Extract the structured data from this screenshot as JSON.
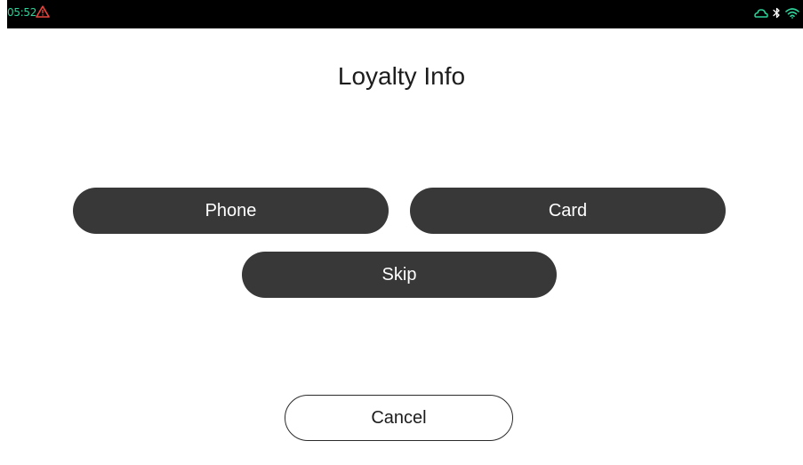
{
  "status_bar": {
    "time": "05:52",
    "warning_color": "#e8453c",
    "time_color": "#2fd39a",
    "icons": [
      "warning-icon",
      "cloud-icon",
      "bluetooth-icon",
      "wifi-icon"
    ]
  },
  "screen": {
    "title": "Loyalty Info"
  },
  "buttons": {
    "phone_label": "Phone",
    "card_label": "Card",
    "skip_label": "Skip",
    "cancel_label": "Cancel"
  },
  "colors": {
    "primary_button": "#383838",
    "primary_text": "#ffffff",
    "background": "#ffffff"
  }
}
